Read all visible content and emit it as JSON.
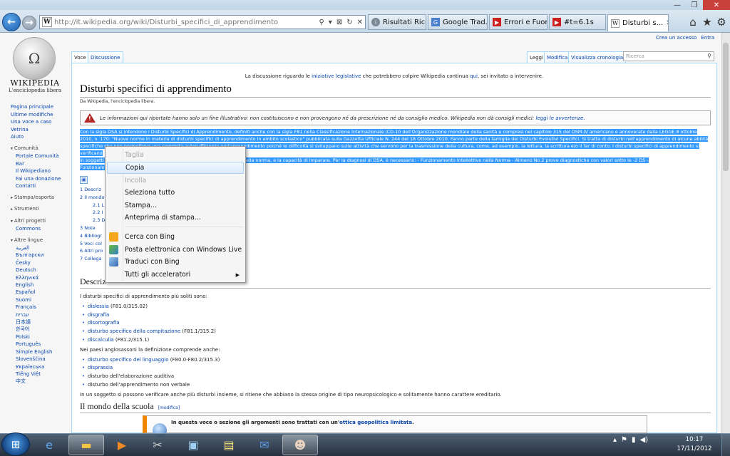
{
  "browser": {
    "url": "http://it.wikipedia.org/wiki/Disturbi_specifici_di_apprendimento",
    "favicon": "W",
    "tabs": [
      {
        "label": "Risultati Rice...",
        "icon": "info-icon",
        "color": "#7a8794"
      },
      {
        "label": "Google Trad...",
        "icon": "google-translate-icon",
        "color": "#4a7fd0"
      },
      {
        "label": "Errori e Fuori...",
        "icon": "youtube-icon",
        "color": "#cc1f1f"
      },
      {
        "label": "#t=6.1s",
        "icon": "youtube-icon",
        "color": "#cc1f1f"
      },
      {
        "label": "Disturbi s...",
        "icon": "wikipedia-icon",
        "color": "#ffffff",
        "active": true
      }
    ]
  },
  "wiki": {
    "personal": {
      "create_account": "Crea un accesso",
      "login": "Entra"
    },
    "logo_name": "WIKIPEDIA",
    "logo_tagline": "L'enciclopedia libera",
    "nav": {
      "main": [
        "Pagina principale",
        "Ultime modifiche",
        "Una voce a caso",
        "Vetrina",
        "Aiuto"
      ],
      "community_head": "Comunità",
      "community": [
        "Portale Comunità",
        "Bar",
        "Il Wikipediano",
        "Fai una donazione",
        "Contatti"
      ],
      "print_head": "Stampa/esporta",
      "tools_head": "Strumenti",
      "projects_head": "Altri progetti",
      "projects": [
        "Commons"
      ],
      "languages_head": "Altre lingue",
      "languages": [
        "العربية",
        "Български",
        "Česky",
        "Deutsch",
        "Ελληνικά",
        "English",
        "Español",
        "Suomi",
        "Français",
        "עברית",
        "日本語",
        "한국어",
        "Polski",
        "Português",
        "Simple English",
        "Slovenščina",
        "Українська",
        "Tiếng Việt",
        "中文"
      ]
    },
    "tabs": {
      "voce": "Voce",
      "discussione": "Discussione",
      "leggi": "Leggi",
      "modifica": "Modifica",
      "cronologia": "Visualizza cronologia"
    },
    "search_placeholder": "Ricerca",
    "sitenotice": {
      "pre": "La discussione riguardo le ",
      "link1": "iniziative legislative",
      "mid": " che potrebbero colpire Wikipedia continua ",
      "link2": "qui",
      "post": ", sei invitato a intervenire."
    },
    "title": "Disturbi specifici di apprendimento",
    "site_sub": "Da Wikipedia, l'enciclopedia libera.",
    "warning": {
      "text": "Le informazioni qui riportate hanno solo un fine illustrativo: non costituiscono e non provengono né da prescrizione né da consiglio medico. Wikipedia non dà consigli medici: ",
      "link": "leggi le avvertenze."
    },
    "selected_lines": [
      "Con la sigla DSA si intendono i Disturbi Specifici di Apprendimento, definiti anche con la sigla F81 nella Classificazione Internazionale ICD-10 dell'Organizzazione mondiale della sanità e compresi nel capitolo 315 del DSM-IV americano e annoverate dalla LEGGE 8 ottobre",
      "2010, n. 170: \"Nuove norme in materia di disturbi specifici di apprendimento in ambito scolastico\" pubblicata sulla Gazzetta Ufficiale N. 244 del 18 Ottobre 2010. Fanno parte della famiglia dei Disturbi Evolutivi Specifici. Si tratta di disturbi nell'apprendimento di alcune abilità",
      "specifiche che non permettono una completa autosufficienza nell'apprendimento poiché le difficoltà si sviluppano sulle attività che servono per la trasmissione della cultura, come, ad esempio, la lettura, la scrittura e/o il far di conto. I disturbi specifici di apprendimento si verificano",
      "in soggetti                                                                     fisiche e mentali nella norma, e la capacità di imparare. Per la diagnosi di DSA, è necessario: - Funzionamento Intellettivo nella Norma - Almeno No.2 prove diagnostiche con valori sotto le -2 DS -",
      "Funzionam"
    ],
    "toc": [
      "1 Descriz",
      "2 Il mondo",
      "2.1 L",
      "2.2 I",
      "2.3 D",
      "3 Note",
      "4 Bibliogr",
      "5 Voci col",
      "6 Altri pro",
      "7 Collega"
    ],
    "section_descr": "Descriz",
    "descr_intro": "I disturbi specifici di apprendimento più soliti sono:",
    "descr_list": [
      {
        "link": "dislessia",
        "rest": " (F81.0/315.02)"
      },
      {
        "link": "disgrafia",
        "rest": ""
      },
      {
        "link": "disortografia",
        "rest": ""
      },
      {
        "link": "disturbo specifico della compitazione",
        "rest": " (F81.1/315.2)"
      },
      {
        "link": "discalculia",
        "rest": " (F81.2/315.1)"
      }
    ],
    "anglo_intro": "Nei paesi anglosassoni la definizione comprende anche:",
    "anglo_list": [
      {
        "link": "disturbo specifico del linguaggio",
        "rest": " (F80.0-F80.2/315.3)"
      },
      {
        "link": "disprassia",
        "rest": ""
      },
      {
        "link": "",
        "rest": "disturbo dell'elaborazione auditiva"
      },
      {
        "link": "",
        "rest": "disturbo dell'apprendimento non verbale"
      }
    ],
    "closing": "In un soggetto si possono verificare anche più disturbi insieme, si ritiene che abbiano la stessa origine di tipo neuropsicologico e solitamente hanno carattere ereditario.",
    "section_scuola": "Il mondo della scuola",
    "edit_link": "[modifica]",
    "notice2": {
      "pre": "In questa voce o sezione gli argomenti sono trattati con un'",
      "link": "ottica geopolitica limitata",
      "post": "."
    }
  },
  "context_menu": [
    {
      "label": "Taglia",
      "disabled": true
    },
    {
      "label": "Copia",
      "highlighted": true
    },
    {
      "label": "Incolla",
      "disabled": true
    },
    {
      "label": "Seleziona tutto"
    },
    {
      "label": "Stampa..."
    },
    {
      "label": "Anteprima di stampa..."
    },
    {
      "label": "Cerca con Bing",
      "icon": "bing-icon"
    },
    {
      "label": "Posta elettronica con Windows Live",
      "icon": "mail-icon"
    },
    {
      "label": "Traduci con Bing",
      "icon": "translate-icon"
    },
    {
      "label": "Tutti gli acceleratori",
      "submenu": true
    }
  ],
  "taskbar": {
    "items": [
      "internet-explorer-icon",
      "folder-icon",
      "media-player-icon",
      "paint-icon",
      "image-viewer-icon",
      "sticky-notes-icon",
      "thunderbird-icon",
      "game-icon"
    ],
    "time": "10:17",
    "date": "17/11/2012"
  }
}
